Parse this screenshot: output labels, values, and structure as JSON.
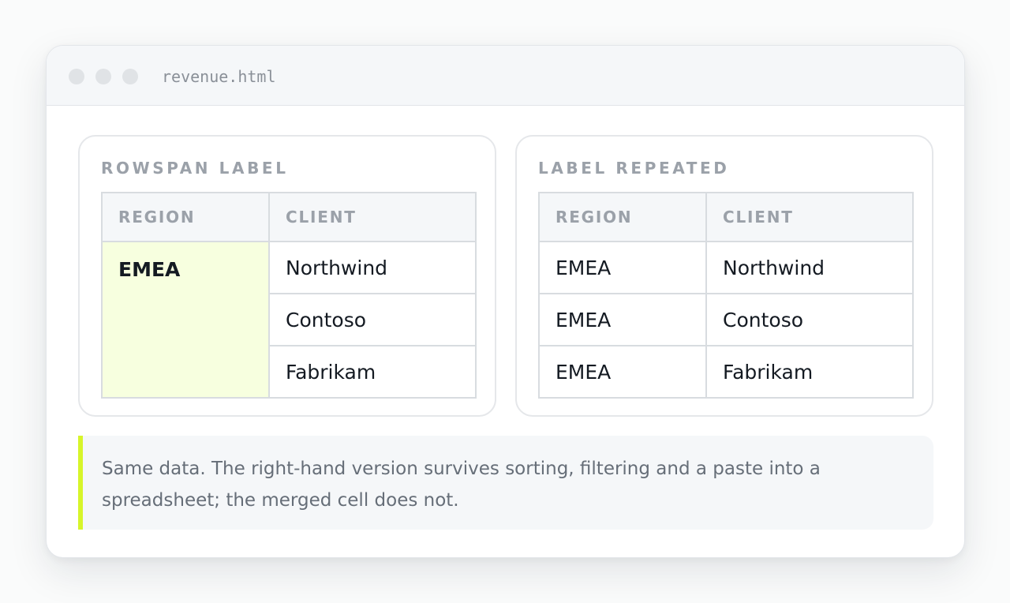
{
  "window": {
    "filename": "revenue.html"
  },
  "panels": {
    "rowspan": {
      "title": "ROWSPAN LABEL",
      "headers": [
        "REGION",
        "CLIENT"
      ],
      "region": "EMEA",
      "clients": [
        "Northwind",
        "Contoso",
        "Fabrikam"
      ]
    },
    "repeated": {
      "title": "LABEL REPEATED",
      "headers": [
        "REGION",
        "CLIENT"
      ],
      "rows": [
        {
          "region": "EMEA",
          "client": "Northwind"
        },
        {
          "region": "EMEA",
          "client": "Contoso"
        },
        {
          "region": "EMEA",
          "client": "Fabrikam"
        }
      ]
    }
  },
  "note": {
    "text": "Same data. The right-hand version survives sorting, filtering and a paste into a spreadsheet; the merged cell does not."
  },
  "colors": {
    "accent": "#d7f52a",
    "merged_cell_bg": "#f7ffdf"
  }
}
